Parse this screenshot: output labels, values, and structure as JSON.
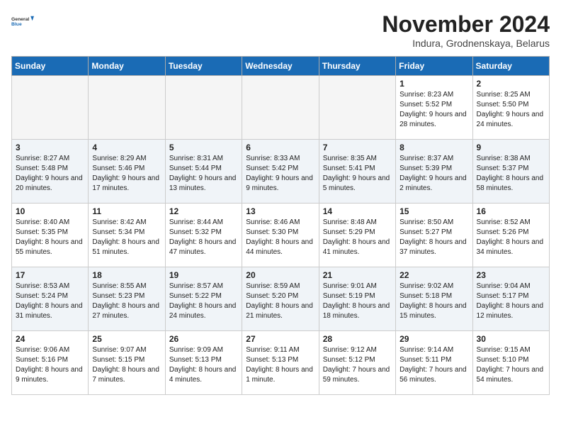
{
  "logo": {
    "line1": "General",
    "line2": "Blue"
  },
  "title": "November 2024",
  "location": "Indura, Grodnenskaya, Belarus",
  "weekdays": [
    "Sunday",
    "Monday",
    "Tuesday",
    "Wednesday",
    "Thursday",
    "Friday",
    "Saturday"
  ],
  "weeks": [
    [
      {
        "day": "",
        "info": ""
      },
      {
        "day": "",
        "info": ""
      },
      {
        "day": "",
        "info": ""
      },
      {
        "day": "",
        "info": ""
      },
      {
        "day": "",
        "info": ""
      },
      {
        "day": "1",
        "info": "Sunrise: 8:23 AM\nSunset: 5:52 PM\nDaylight: 9 hours and 28 minutes."
      },
      {
        "day": "2",
        "info": "Sunrise: 8:25 AM\nSunset: 5:50 PM\nDaylight: 9 hours and 24 minutes."
      }
    ],
    [
      {
        "day": "3",
        "info": "Sunrise: 8:27 AM\nSunset: 5:48 PM\nDaylight: 9 hours and 20 minutes."
      },
      {
        "day": "4",
        "info": "Sunrise: 8:29 AM\nSunset: 5:46 PM\nDaylight: 9 hours and 17 minutes."
      },
      {
        "day": "5",
        "info": "Sunrise: 8:31 AM\nSunset: 5:44 PM\nDaylight: 9 hours and 13 minutes."
      },
      {
        "day": "6",
        "info": "Sunrise: 8:33 AM\nSunset: 5:42 PM\nDaylight: 9 hours and 9 minutes."
      },
      {
        "day": "7",
        "info": "Sunrise: 8:35 AM\nSunset: 5:41 PM\nDaylight: 9 hours and 5 minutes."
      },
      {
        "day": "8",
        "info": "Sunrise: 8:37 AM\nSunset: 5:39 PM\nDaylight: 9 hours and 2 minutes."
      },
      {
        "day": "9",
        "info": "Sunrise: 8:38 AM\nSunset: 5:37 PM\nDaylight: 8 hours and 58 minutes."
      }
    ],
    [
      {
        "day": "10",
        "info": "Sunrise: 8:40 AM\nSunset: 5:35 PM\nDaylight: 8 hours and 55 minutes."
      },
      {
        "day": "11",
        "info": "Sunrise: 8:42 AM\nSunset: 5:34 PM\nDaylight: 8 hours and 51 minutes."
      },
      {
        "day": "12",
        "info": "Sunrise: 8:44 AM\nSunset: 5:32 PM\nDaylight: 8 hours and 47 minutes."
      },
      {
        "day": "13",
        "info": "Sunrise: 8:46 AM\nSunset: 5:30 PM\nDaylight: 8 hours and 44 minutes."
      },
      {
        "day": "14",
        "info": "Sunrise: 8:48 AM\nSunset: 5:29 PM\nDaylight: 8 hours and 41 minutes."
      },
      {
        "day": "15",
        "info": "Sunrise: 8:50 AM\nSunset: 5:27 PM\nDaylight: 8 hours and 37 minutes."
      },
      {
        "day": "16",
        "info": "Sunrise: 8:52 AM\nSunset: 5:26 PM\nDaylight: 8 hours and 34 minutes."
      }
    ],
    [
      {
        "day": "17",
        "info": "Sunrise: 8:53 AM\nSunset: 5:24 PM\nDaylight: 8 hours and 31 minutes."
      },
      {
        "day": "18",
        "info": "Sunrise: 8:55 AM\nSunset: 5:23 PM\nDaylight: 8 hours and 27 minutes."
      },
      {
        "day": "19",
        "info": "Sunrise: 8:57 AM\nSunset: 5:22 PM\nDaylight: 8 hours and 24 minutes."
      },
      {
        "day": "20",
        "info": "Sunrise: 8:59 AM\nSunset: 5:20 PM\nDaylight: 8 hours and 21 minutes."
      },
      {
        "day": "21",
        "info": "Sunrise: 9:01 AM\nSunset: 5:19 PM\nDaylight: 8 hours and 18 minutes."
      },
      {
        "day": "22",
        "info": "Sunrise: 9:02 AM\nSunset: 5:18 PM\nDaylight: 8 hours and 15 minutes."
      },
      {
        "day": "23",
        "info": "Sunrise: 9:04 AM\nSunset: 5:17 PM\nDaylight: 8 hours and 12 minutes."
      }
    ],
    [
      {
        "day": "24",
        "info": "Sunrise: 9:06 AM\nSunset: 5:16 PM\nDaylight: 8 hours and 9 minutes."
      },
      {
        "day": "25",
        "info": "Sunrise: 9:07 AM\nSunset: 5:15 PM\nDaylight: 8 hours and 7 minutes."
      },
      {
        "day": "26",
        "info": "Sunrise: 9:09 AM\nSunset: 5:13 PM\nDaylight: 8 hours and 4 minutes."
      },
      {
        "day": "27",
        "info": "Sunrise: 9:11 AM\nSunset: 5:13 PM\nDaylight: 8 hours and 1 minute."
      },
      {
        "day": "28",
        "info": "Sunrise: 9:12 AM\nSunset: 5:12 PM\nDaylight: 7 hours and 59 minutes."
      },
      {
        "day": "29",
        "info": "Sunrise: 9:14 AM\nSunset: 5:11 PM\nDaylight: 7 hours and 56 minutes."
      },
      {
        "day": "30",
        "info": "Sunrise: 9:15 AM\nSunset: 5:10 PM\nDaylight: 7 hours and 54 minutes."
      }
    ]
  ]
}
